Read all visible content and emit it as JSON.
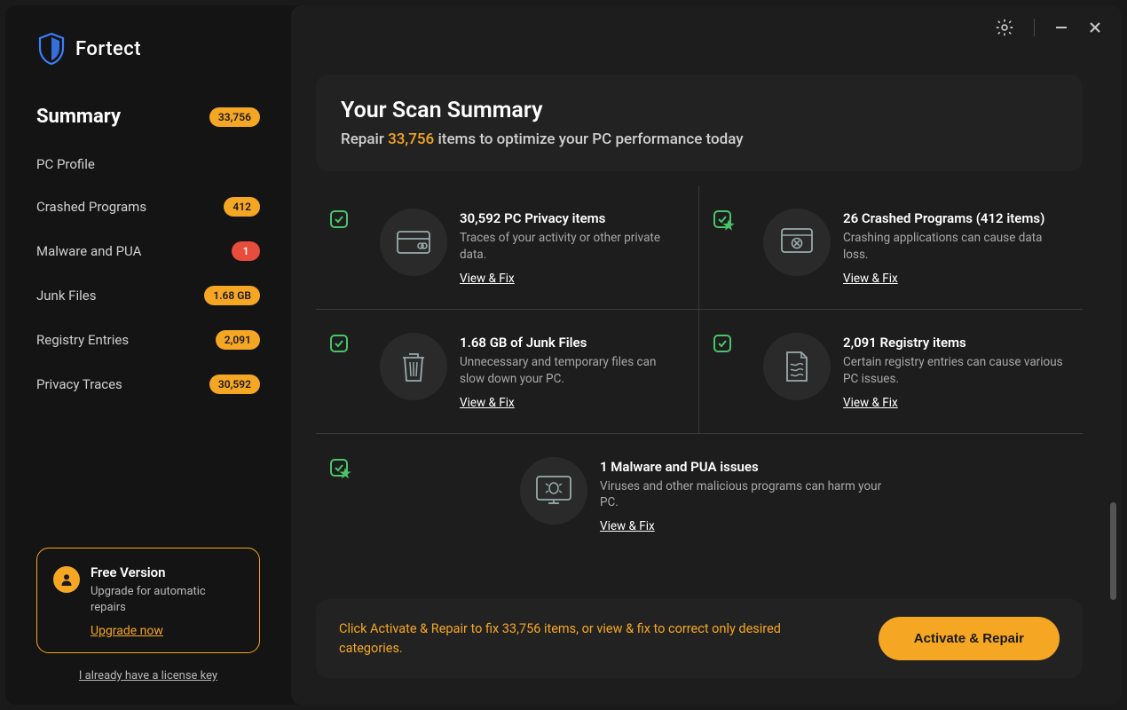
{
  "brand": {
    "name": "Fortect"
  },
  "sidebar": {
    "items": [
      {
        "label": "Summary",
        "badge": "33,756",
        "active": true
      },
      {
        "label": "PC Profile",
        "badge": ""
      },
      {
        "label": "Crashed Programs",
        "badge": "412"
      },
      {
        "label": "Malware and PUA",
        "badge": "1",
        "badge_red": true
      },
      {
        "label": "Junk Files",
        "badge": "1.68 GB"
      },
      {
        "label": "Registry Entries",
        "badge": "2,091"
      },
      {
        "label": "Privacy Traces",
        "badge": "30,592"
      }
    ]
  },
  "upgrade_card": {
    "title": "Free Version",
    "desc": "Upgrade for automatic repairs",
    "link": "Upgrade now"
  },
  "license_link": "I already have a license key",
  "header": {
    "title": "Your Scan Summary",
    "sub_prefix": "Repair ",
    "sub_count": "33,756",
    "sub_suffix": " items to optimize your PC performance today"
  },
  "cards": {
    "privacy": {
      "title": "30,592 PC Privacy items",
      "desc": "Traces of your activity or other private data.",
      "link": "View & Fix"
    },
    "crashed": {
      "title": "26 Crashed Programs (412 items)",
      "desc": "Crashing applications can cause data loss.",
      "link": "View & Fix"
    },
    "junk": {
      "title": "1.68 GB of Junk Files",
      "desc": "Unnecessary and temporary files can slow down your PC.",
      "link": "View & Fix"
    },
    "registry": {
      "title": "2,091 Registry items",
      "desc": "Certain registry entries can cause various PC issues.",
      "link": "View & Fix"
    },
    "malware": {
      "title": "1 Malware and PUA issues",
      "desc": "Viruses and other malicious programs can harm your PC.",
      "link": "View & Fix"
    }
  },
  "footer": {
    "text": "Click Activate & Repair to fix 33,756 items, or view & fix to correct only desired categories.",
    "button": "Activate & Repair"
  },
  "colors": {
    "accent": "#f5a623",
    "success": "#4ac46a",
    "danger": "#e74c3c",
    "bg_dark": "#141414",
    "bg_panel": "#1d1d1d",
    "bg_card": "#222222"
  }
}
